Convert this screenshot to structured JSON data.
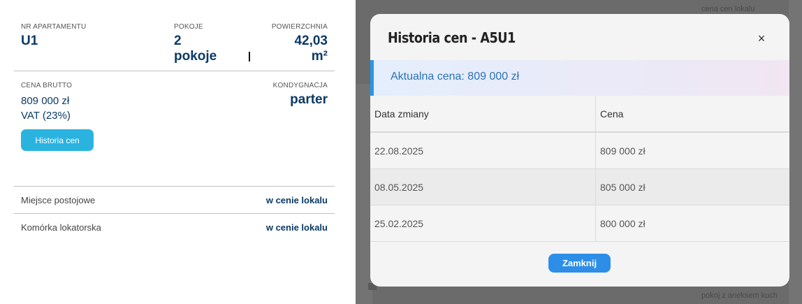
{
  "apartment": {
    "number_label": "NR APARTAMENTU",
    "number": "U1",
    "rooms_label": "POKOJE",
    "rooms_line1": "2",
    "rooms_line2": "pokoje",
    "area_label": "POWIERZCHNIA",
    "area_line1": "42,03",
    "area_line2": "m²",
    "price_label": "CENA BRUTTO",
    "price_line1": "809 000 zł",
    "price_line2": "VAT (23%)",
    "floor_label": "KONDYGNACJA",
    "floor": "parter",
    "history_button": "Historia cen",
    "parking_label": "Miejsce postojowe",
    "parking_value": "w cenie lokalu",
    "storage_label": "Komórka lokatorska",
    "storage_value": "w cenie lokalu"
  },
  "background": {
    "top_text": "cena cen lokalu",
    "bottom_text": "pokoj z aneksem kuch"
  },
  "modal": {
    "title": "Historia cen - A5U1",
    "close_icon": "×",
    "current_price": "Aktualna cena: 809 000 zł",
    "columns": [
      "Data zmiany",
      "Cena"
    ],
    "rows": [
      [
        "22.08.2025",
        "809 000 zł"
      ],
      [
        "08.05.2025",
        "805 000 zł"
      ],
      [
        "25.02.2025",
        "800 000 zł"
      ]
    ],
    "close_button": "Zamknij"
  },
  "colors": {
    "brand_dark": "#0b3a66",
    "history_button": "#2bb3e0",
    "primary_button": "#2d8ee8",
    "current_price_text": "#2a72b8"
  }
}
